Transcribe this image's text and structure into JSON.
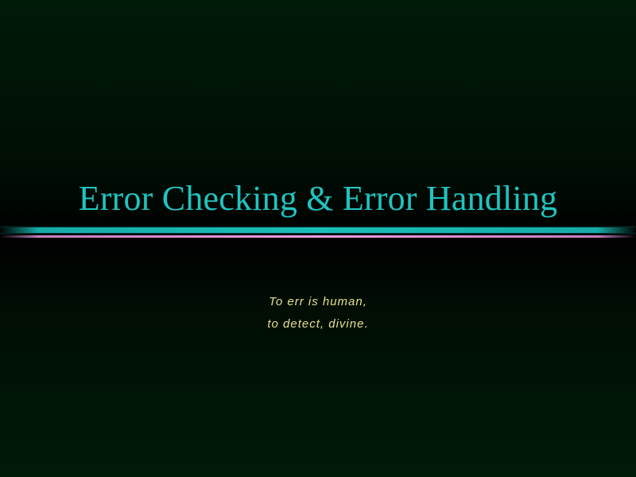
{
  "slide": {
    "title": "Error Checking & Error Handling",
    "subtitle_lines": [
      "To err is human,",
      "to detect, divine."
    ]
  },
  "colors": {
    "background": "#001a08",
    "title": "#1fc4c0",
    "subtitle": "#e6e08c",
    "rule_primary": "#19c0b8",
    "rule_secondary": "#eba0e2"
  }
}
